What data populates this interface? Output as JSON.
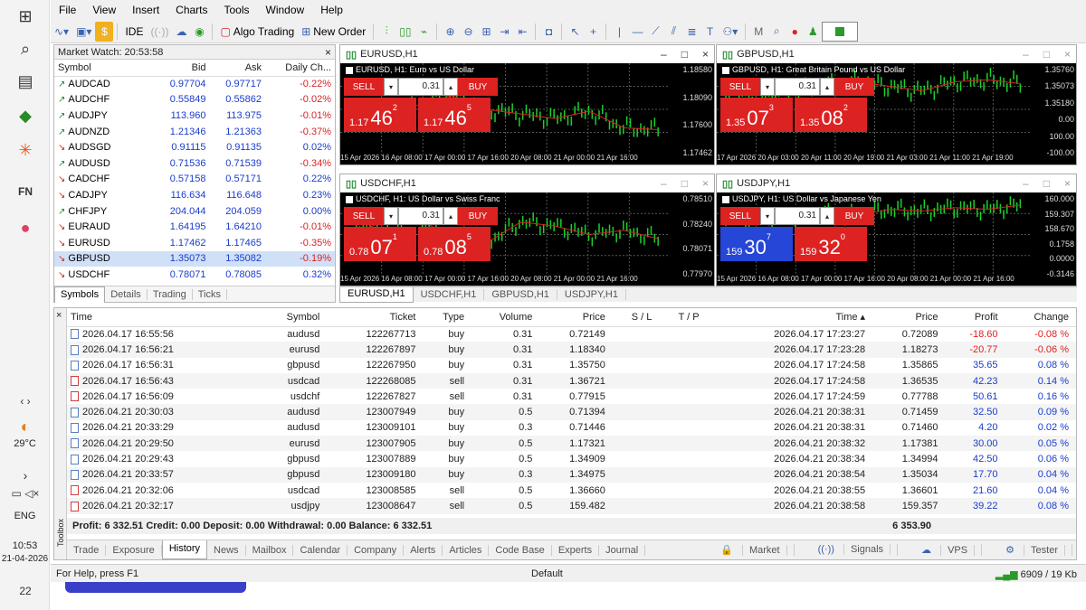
{
  "menu": [
    "File",
    "View",
    "Insert",
    "Charts",
    "Tools",
    "Window",
    "Help"
  ],
  "toolbar": {
    "ide": "IDE",
    "algo": "Algo Trading",
    "new_order": "New Order"
  },
  "taskbar": {
    "weather": "29°C",
    "lang": "ENG",
    "time": "10:53",
    "date": "21-04-2026",
    "notif": "22"
  },
  "mw": {
    "title": "Market Watch: 20:53:58",
    "cols": [
      "Symbol",
      "Bid",
      "Ask",
      "Daily Ch..."
    ],
    "rows": [
      {
        "s": "AUDCAD",
        "b": "0.97704",
        "a": "0.97717",
        "c": "-0.22%",
        "up": true
      },
      {
        "s": "AUDCHF",
        "b": "0.55849",
        "a": "0.55862",
        "c": "-0.02%",
        "up": true
      },
      {
        "s": "AUDJPY",
        "b": "113.960",
        "a": "113.975",
        "c": "-0.01%",
        "up": true
      },
      {
        "s": "AUDNZD",
        "b": "1.21346",
        "a": "1.21363",
        "c": "-0.37%",
        "up": true
      },
      {
        "s": "AUDSGD",
        "b": "0.91115",
        "a": "0.91135",
        "c": "0.02%",
        "up": false
      },
      {
        "s": "AUDUSD",
        "b": "0.71536",
        "a": "0.71539",
        "c": "-0.34%",
        "up": true
      },
      {
        "s": "CADCHF",
        "b": "0.57158",
        "a": "0.57171",
        "c": "0.22%",
        "up": false
      },
      {
        "s": "CADJPY",
        "b": "116.634",
        "a": "116.648",
        "c": "0.23%",
        "up": false
      },
      {
        "s": "CHFJPY",
        "b": "204.044",
        "a": "204.059",
        "c": "0.00%",
        "up": true
      },
      {
        "s": "EURAUD",
        "b": "1.64195",
        "a": "1.64210",
        "c": "-0.01%",
        "up": false
      },
      {
        "s": "EURUSD",
        "b": "1.17462",
        "a": "1.17465",
        "c": "-0.35%",
        "up": false
      },
      {
        "s": "GBPUSD",
        "b": "1.35073",
        "a": "1.35082",
        "c": "-0.19%",
        "up": false
      },
      {
        "s": "USDCHF",
        "b": "0.78071",
        "a": "0.78085",
        "c": "0.32%",
        "up": false
      }
    ],
    "tabs": [
      "Symbols",
      "Details",
      "Trading",
      "Ticks"
    ]
  },
  "charts": [
    {
      "name": "EURUSD,H1",
      "title": "EURUSD, H1:  Euro vs US Dollar",
      "vol": "0.31",
      "sell_a": "1.17",
      "sell_b": "46",
      "sell_c": "2",
      "buy_a": "1.17",
      "buy_b": "46",
      "buy_c": "5",
      "y": [
        "1.18580",
        "1.18090",
        "1.17600",
        "1.17462"
      ],
      "x": "15 Apr 2026   16 Apr 08:00   17 Apr 00:00   17 Apr 16:00   20 Apr 08:00   21 Apr 00:00   21 Apr 16:00"
    },
    {
      "name": "GBPUSD,H1",
      "title": "GBPUSD, H1:  Great Britain Pound vs US Dollar",
      "vol": "0.31",
      "sell_a": "1.35",
      "sell_b": "07",
      "sell_c": "3",
      "buy_a": "1.35",
      "buy_b": "08",
      "buy_c": "2",
      "y": [
        "1.35760",
        "1.35073",
        "1.35180",
        "0.00",
        "100.00",
        "-100.00"
      ],
      "x": "17 Apr 2026   20 Apr 03:00   20 Apr 11:00   20 Apr 19:00   21 Apr 03:00   21 Apr 11:00   21 Apr 19:00"
    },
    {
      "name": "USDCHF,H1",
      "title": "USDCHF, H1:  US Dollar vs Swiss Franc",
      "vol": "0.31",
      "sell_a": "0.78",
      "sell_b": "07",
      "sell_c": "1",
      "buy_a": "0.78",
      "buy_b": "08",
      "buy_c": "5",
      "y": [
        "0.78510",
        "0.78240",
        "0.78071",
        "0.77970"
      ],
      "x": "15 Apr 2026   16 Apr 08:00   17 Apr 00:00   17 Apr 16:00   20 Apr 08:00   21 Apr 00:00   21 Apr 16:00"
    },
    {
      "name": "USDJPY,H1",
      "title": "USDJPY, H1:  US Dollar vs Japanese Yen",
      "vol": "0.31",
      "sell_a": "159",
      "sell_b": "30",
      "sell_c": "7",
      "buy_a": "159",
      "buy_b": "32",
      "buy_c": "0",
      "y": [
        "160.000",
        "159.307",
        "158.670",
        "0.1758",
        "0.0000",
        "-0.3146"
      ],
      "x": "15 Apr 2026   16 Apr 08:00   17 Apr 00:00   17 Apr 16:00   20 Apr 08:00   21 Apr 00:00   21 Apr 16:00"
    }
  ],
  "chart_tabs": [
    "EURUSD,H1",
    "USDCHF,H1",
    "GBPUSD,H1",
    "USDJPY,H1"
  ],
  "history": {
    "cols": [
      "Time",
      "Symbol",
      "Ticket",
      "Type",
      "Volume",
      "Price",
      "S / L",
      "T / P",
      "Time",
      "Price",
      "Profit",
      "Change"
    ],
    "rows": [
      [
        "2026.04.17 16:55:56",
        "audusd",
        "122267713",
        "buy",
        "0.31",
        "0.72149",
        "",
        "",
        "2026.04.17 17:23:27",
        "0.72089",
        "-18.60",
        "-0.08 %"
      ],
      [
        "2026.04.17 16:56:21",
        "eurusd",
        "122267897",
        "buy",
        "0.31",
        "1.18340",
        "",
        "",
        "2026.04.17 17:23:28",
        "1.18273",
        "-20.77",
        "-0.06 %"
      ],
      [
        "2026.04.17 16:56:31",
        "gbpusd",
        "122267950",
        "buy",
        "0.31",
        "1.35750",
        "",
        "",
        "2026.04.17 17:24:58",
        "1.35865",
        "35.65",
        "0.08 %"
      ],
      [
        "2026.04.17 16:56:43",
        "usdcad",
        "122268085",
        "sell",
        "0.31",
        "1.36721",
        "",
        "",
        "2026.04.17 17:24:58",
        "1.36535",
        "42.23",
        "0.14 %"
      ],
      [
        "2026.04.17 16:56:09",
        "usdchf",
        "122267827",
        "sell",
        "0.31",
        "0.77915",
        "",
        "",
        "2026.04.17 17:24:59",
        "0.77788",
        "50.61",
        "0.16 %"
      ],
      [
        "2026.04.21 20:30:03",
        "audusd",
        "123007949",
        "buy",
        "0.5",
        "0.71394",
        "",
        "",
        "2026.04.21 20:38:31",
        "0.71459",
        "32.50",
        "0.09 %"
      ],
      [
        "2026.04.21 20:33:29",
        "audusd",
        "123009101",
        "buy",
        "0.3",
        "0.71446",
        "",
        "",
        "2026.04.21 20:38:31",
        "0.71460",
        "4.20",
        "0.02 %"
      ],
      [
        "2026.04.21 20:29:50",
        "eurusd",
        "123007905",
        "buy",
        "0.5",
        "1.17321",
        "",
        "",
        "2026.04.21 20:38:32",
        "1.17381",
        "30.00",
        "0.05 %"
      ],
      [
        "2026.04.21 20:29:43",
        "gbpusd",
        "123007889",
        "buy",
        "0.5",
        "1.34909",
        "",
        "",
        "2026.04.21 20:38:34",
        "1.34994",
        "42.50",
        "0.06 %"
      ],
      [
        "2026.04.21 20:33:57",
        "gbpusd",
        "123009180",
        "buy",
        "0.3",
        "1.34975",
        "",
        "",
        "2026.04.21 20:38:54",
        "1.35034",
        "17.70",
        "0.04 %"
      ],
      [
        "2026.04.21 20:32:06",
        "usdcad",
        "123008585",
        "sell",
        "0.5",
        "1.36660",
        "",
        "",
        "2026.04.21 20:38:55",
        "1.36601",
        "21.60",
        "0.04 %"
      ],
      [
        "2026.04.21 20:32:17",
        "usdjpy",
        "123008647",
        "sell",
        "0.5",
        "159.482",
        "",
        "",
        "2026.04.21 20:38:58",
        "159.357",
        "39.22",
        "0.08 %"
      ]
    ],
    "summary": "Profit: 6 332.51  Credit: 0.00  Deposit: 0.00  Withdrawal: 0.00  Balance: 6 332.51",
    "total": "6 353.90"
  },
  "toolbox_tabs": [
    "Trade",
    "Exposure",
    "History",
    "News",
    "Mailbox",
    "Calendar",
    "Company",
    "Alerts",
    "Articles",
    "Code Base",
    "Experts",
    "Journal"
  ],
  "toolbox_right": [
    "Market",
    "Signals",
    "VPS",
    "Tester"
  ],
  "toolbox_label": "Toolbox",
  "status": {
    "help": "For Help, press F1",
    "profile": "Default",
    "traffic": "6909 / 19 Kb"
  },
  "trade": {
    "sell": "SELL",
    "buy": "BUY"
  }
}
